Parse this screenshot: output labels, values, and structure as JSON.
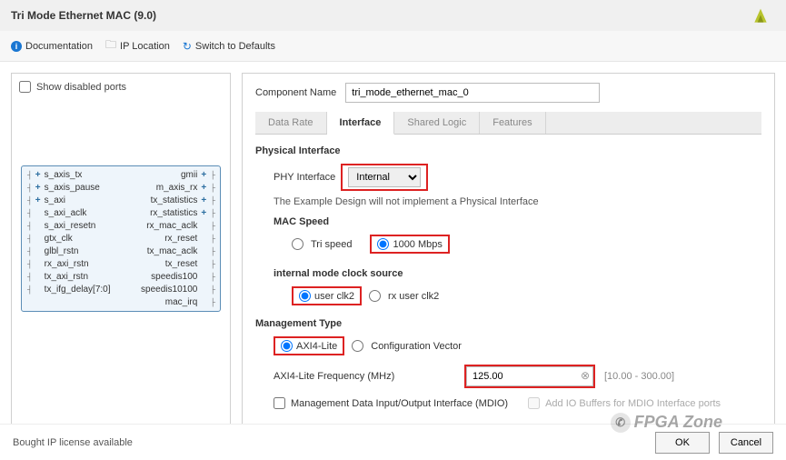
{
  "title": "Tri Mode Ethernet MAC (9.0)",
  "actions": {
    "documentation": "Documentation",
    "ip_location": "IP Location",
    "switch_defaults": "Switch to Defaults"
  },
  "left": {
    "show_disabled": "Show disabled ports",
    "ports_left": [
      "s_axis_tx",
      "s_axis_pause",
      "s_axi",
      "s_axi_aclk",
      "s_axi_resetn",
      "gtx_clk",
      "glbl_rstn",
      "rx_axi_rstn",
      "tx_axi_rstn",
      "tx_ifg_delay[7:0]"
    ],
    "ports_right": [
      "gmii",
      "m_axis_rx",
      "tx_statistics",
      "rx_statistics",
      "rx_mac_aclk",
      "rx_reset",
      "tx_mac_aclk",
      "tx_reset",
      "speedis100",
      "speedis10100",
      "mac_irq"
    ]
  },
  "component": {
    "label": "Component Name",
    "value": "tri_mode_ethernet_mac_0"
  },
  "tabs": [
    "Data Rate",
    "Interface",
    "Shared Logic",
    "Features"
  ],
  "physical": {
    "heading": "Physical Interface",
    "phy_label": "PHY Interface",
    "phy_value": "Internal",
    "note": "The Example Design will not implement a Physical Interface",
    "mac_speed": "MAC Speed",
    "tri_speed": "Tri speed",
    "rate_1000": "1000 Mbps",
    "clock_src": "internal mode clock source",
    "user_clk2": "user clk2",
    "rx_user_clk2": "rx user clk2"
  },
  "mgmt": {
    "heading": "Management Type",
    "axi4": "AXI4-Lite",
    "config_vec": "Configuration Vector",
    "freq_label": "AXI4-Lite Frequency (MHz)",
    "freq_value": "125.00",
    "freq_range": "[10.00 - 300.00]",
    "mdio": "Management Data Input/Output Interface (MDIO)",
    "mdio_buffers": "Add IO Buffers for MDIO Interface ports"
  },
  "footer": {
    "status": "Bought IP license available",
    "ok": "OK",
    "cancel": "Cancel"
  },
  "watermark": "FPGA Zone"
}
